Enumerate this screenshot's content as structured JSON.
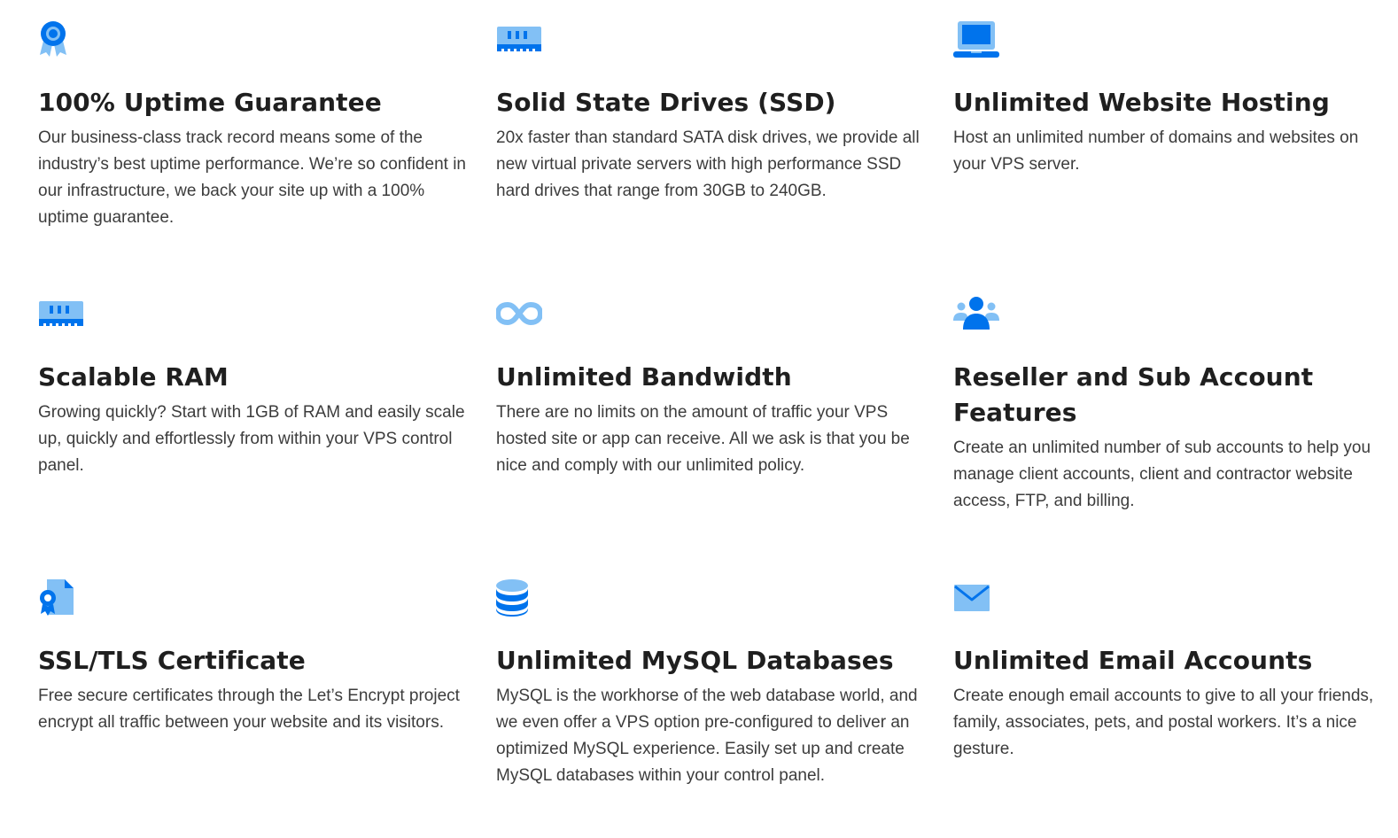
{
  "colors": {
    "accent_blue": "#0073ec",
    "light_blue": "#82c0f5",
    "title_text": "#1f1f1f",
    "body_text": "#3c3c3c"
  },
  "features": [
    {
      "icon": "ribbon-award-icon",
      "title": "100% Uptime Guarantee",
      "description": "Our business-class track record means some of the industry’s best uptime performance. We’re so confident in our infrastructure, we back your site up with a 100% uptime guarantee."
    },
    {
      "icon": "ssd-drive-icon",
      "title": "Solid State Drives (SSD)",
      "description": "20x faster than standard SATA disk drives, we provide all new virtual private servers with high performance SSD hard drives that range from 30GB to 240GB."
    },
    {
      "icon": "laptop-icon",
      "title": "Unlimited Website Hosting",
      "description": "Host an unlimited number of domains and websites on your VPS server."
    },
    {
      "icon": "ram-module-icon",
      "title": "Scalable RAM",
      "description": "Growing quickly? Start with 1GB of RAM and easily scale up, quickly and effortlessly from within your VPS control panel."
    },
    {
      "icon": "infinity-icon",
      "title": "Unlimited Bandwidth",
      "description": "There are no limits on the amount of traffic your VPS hosted site or app can receive. All we ask is that you be nice and comply with our unlimited policy."
    },
    {
      "icon": "user-group-icon",
      "title": "Reseller and Sub Account Features",
      "description": "Create an unlimited number of sub accounts to help you manage client accounts, client and contractor website access, FTP, and billing."
    },
    {
      "icon": "certificate-icon",
      "title": "SSL/TLS Certificate",
      "description": "Free secure certificates through the Let’s Encrypt project encrypt all traffic between your website and its visitors."
    },
    {
      "icon": "database-icon",
      "title": "Unlimited MySQL Databases",
      "description": "MySQL is the workhorse of the web database world, and we even offer a VPS option pre-configured to deliver an optimized MySQL experience. Easily set up and create MySQL databases within your control panel."
    },
    {
      "icon": "envelope-icon",
      "title": "Unlimited Email Accounts",
      "description": "Create enough email accounts to give to all your friends, family, associates, pets, and postal workers. It’s a nice gesture."
    }
  ]
}
